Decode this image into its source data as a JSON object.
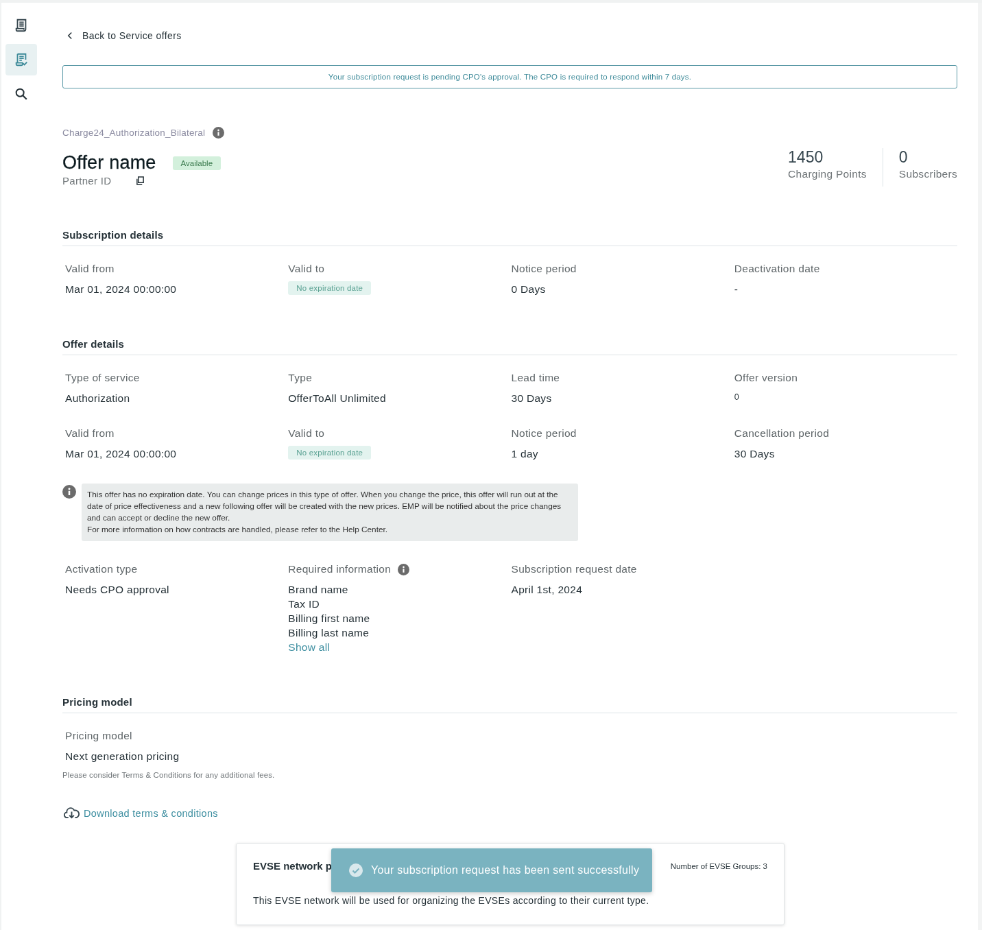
{
  "sidebar": {
    "items": [
      {
        "selected": false
      },
      {
        "selected": true
      },
      {
        "selected": false
      }
    ]
  },
  "back_link": "Back to Service offers",
  "alert": "Your subscription request is pending CPO's approval. The CPO is required to respond within 7 days.",
  "offer": {
    "code": "Charge24_Authorization_Bilateral",
    "name": "Offer name",
    "status": "Available",
    "partner_id_label": "Partner ID"
  },
  "stats": [
    {
      "value": "1450",
      "label": "Charging Points"
    },
    {
      "value": "0",
      "label": "Subscribers"
    }
  ],
  "subscription_details": {
    "title": "Subscription details",
    "fields": [
      {
        "label": "Valid from",
        "kind": "text",
        "value": "Mar 01, 2024 00:00:00"
      },
      {
        "label": "Valid to",
        "kind": "badge",
        "value": "No expiration date"
      },
      {
        "label": "Notice period",
        "kind": "text",
        "value": "0 Days"
      },
      {
        "label": "Deactivation date",
        "kind": "text",
        "value": "-"
      }
    ]
  },
  "offer_details": {
    "title": "Offer details",
    "fields": [
      {
        "label": "Type of service",
        "kind": "text",
        "value": "Authorization"
      },
      {
        "label": "Type",
        "kind": "text",
        "value": "OfferToAll Unlimited"
      },
      {
        "label": "Lead time",
        "kind": "text",
        "value": "30 Days"
      },
      {
        "label": "Offer version",
        "kind": "small",
        "value": "0"
      },
      {
        "label": "Valid from",
        "kind": "text",
        "value": "Mar 01, 2024 00:00:00"
      },
      {
        "label": "Valid to",
        "kind": "badge",
        "value": "No expiration date"
      },
      {
        "label": "Notice period",
        "kind": "text",
        "value": "1 day"
      },
      {
        "label": "Cancellation period",
        "kind": "text",
        "value": "30 Days"
      }
    ]
  },
  "info_note": [
    "This offer has no expiration date. You can change prices in this type of offer. When you change the price, this offer will run out at the date of price effectiveness and a new following offer will be created with the new prices. EMP will be notified about the price changes and can accept or decline the new offer.",
    "For more information on how contracts are handled, please refer to the Help Center."
  ],
  "activation_fields": [
    {
      "label": "Activation type",
      "kind": "text",
      "value": "Needs CPO approval"
    },
    {
      "label": "Required information",
      "kind": "list",
      "info": true,
      "values": [
        "Brand name",
        "Tax ID",
        "Billing first name",
        "Billing last name"
      ],
      "link": "Show all"
    },
    {
      "label": "Subscription request date",
      "kind": "text",
      "value": "April 1st, 2024"
    }
  ],
  "pricing_model": {
    "title": "Pricing model",
    "label": "Pricing model",
    "value": "Next generation pricing",
    "note": "Please consider Terms & Conditions for any additional fees.",
    "download": "Download terms & conditions"
  },
  "evse_card": {
    "title": "EVSE network p",
    "groups": "Number of EVSE Groups: 3",
    "description": "This EVSE network will be used for organizing the EVSEs according to their current type."
  },
  "toast": "Your subscription request has been sent successfully"
}
